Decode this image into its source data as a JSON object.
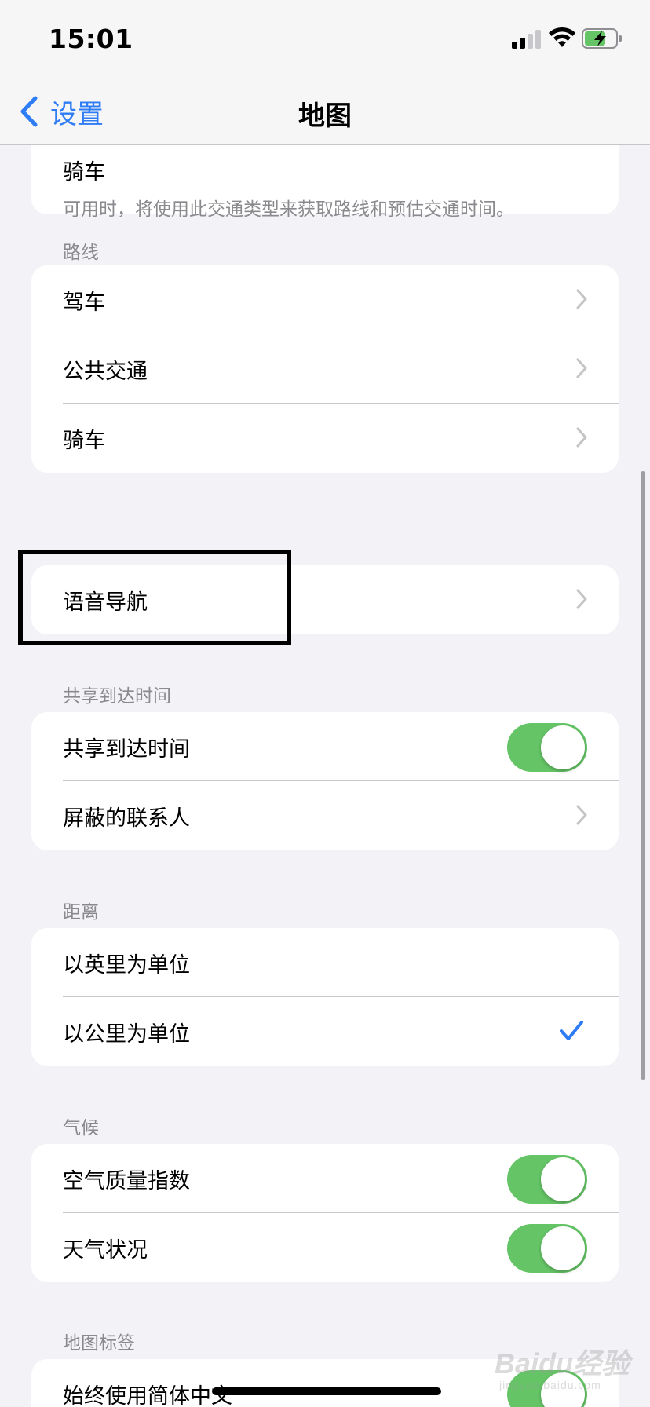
{
  "status_bar": {
    "time": "15:01"
  },
  "nav": {
    "back_label": "设置",
    "title": "地图"
  },
  "top_group": {
    "item": "骑车"
  },
  "top_footer": "可用时，将使用此交通类型来获取路线和预估交通时间。",
  "routes": {
    "header": "路线",
    "items": [
      "驾车",
      "公共交通",
      "骑车"
    ]
  },
  "voice_nav": {
    "label": "语音导航"
  },
  "share_eta": {
    "header": "共享到达时间",
    "toggle_label": "共享到达时间",
    "toggle_on": true,
    "blocked_label": "屏蔽的联系人"
  },
  "distance": {
    "header": "距离",
    "options": [
      "以英里为单位",
      "以公里为单位"
    ],
    "selected": "以公里为单位"
  },
  "climate": {
    "header": "气候",
    "items": [
      {
        "label": "空气质量指数",
        "on": true
      },
      {
        "label": "天气状况",
        "on": true
      }
    ]
  },
  "map_labels": {
    "header": "地图标签",
    "item": "始终使用简体中文",
    "on": true
  },
  "watermark": {
    "text": "Baidu经验",
    "sub": "jingyan.baidu.com"
  },
  "colors": {
    "accent": "#2e7cf6",
    "toggle_on": "#65c466",
    "background": "#f2f2f7"
  }
}
